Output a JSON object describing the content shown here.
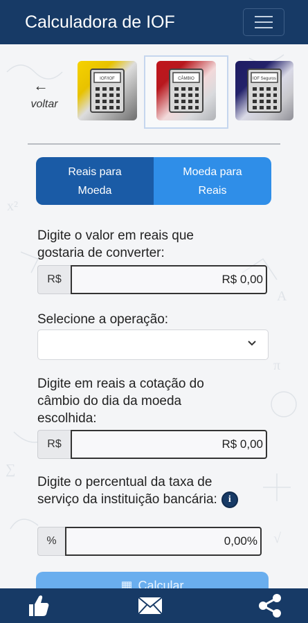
{
  "header": {
    "title": "Calculadora de IOF"
  },
  "nav": {
    "back_label": "voltar"
  },
  "calculators": [
    {
      "name": "IOF",
      "screen_text": "IOF/IOF",
      "color": "#e8c200",
      "selected": false
    },
    {
      "name": "Câmbio",
      "screen_text": "CÂMBIO",
      "color": "#b8181e",
      "selected": true
    },
    {
      "name": "Seguros",
      "screen_text": "IOF Seguros",
      "color": "#23226a",
      "selected": false
    }
  ],
  "toggle": {
    "left_line1": "Reais para",
    "left_line2": "Moeda",
    "right_line1": "Moeda para",
    "right_line2": "Reais"
  },
  "form": {
    "amount_label_line1": "Digite o valor em reais que",
    "amount_label_line2": "gostaria de converter:",
    "amount_prefix": "R$",
    "amount_value": "R$ 0,00",
    "operation_label": "Selecione a operação:",
    "operation_value": "",
    "rate_label_line1": "Digite em reais a cotação do",
    "rate_label_line2": "câmbio do dia da moeda",
    "rate_label_line3": "escolhida:",
    "rate_prefix": "R$",
    "rate_value": "R$ 0,00",
    "fee_label_line1": "Digite o percentual da taxa de",
    "fee_label_line2": "serviço da instituição bancária:",
    "fee_prefix": "%",
    "fee_value": "0,00%",
    "calculate_label": "Calcular"
  },
  "colors": {
    "primary": "#173a66",
    "toggle_active": "#1a5ba6",
    "toggle_inactive": "#2f8ee8",
    "button": "#6aaeee"
  }
}
